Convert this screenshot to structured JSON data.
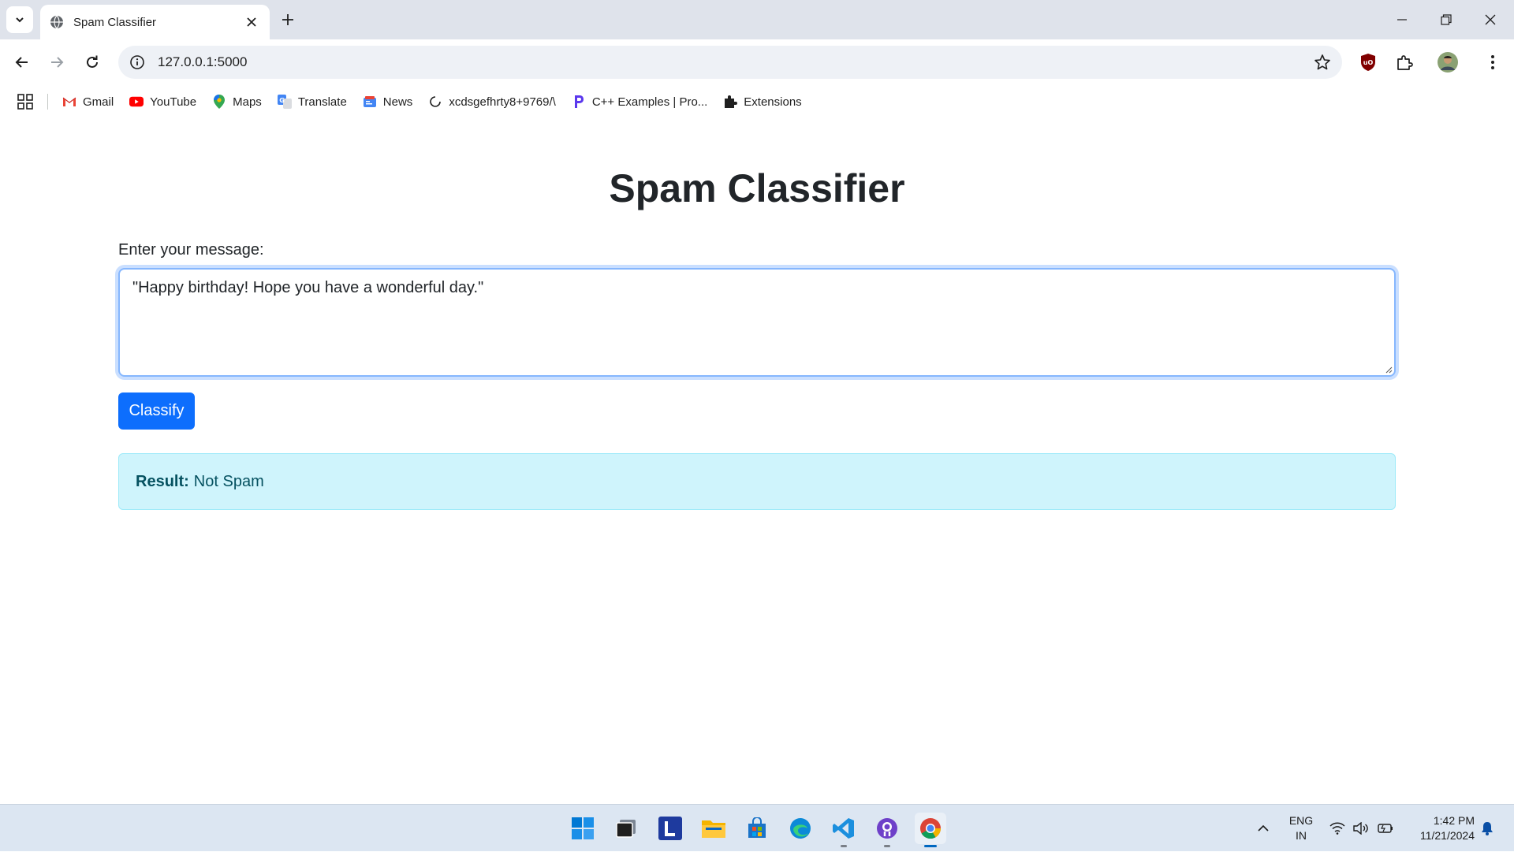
{
  "browser": {
    "tab_title": "Spam Classifier",
    "url": "127.0.0.1:5000",
    "bookmarks": [
      {
        "label": "Gmail",
        "icon": "gmail-icon"
      },
      {
        "label": "YouTube",
        "icon": "youtube-icon"
      },
      {
        "label": "Maps",
        "icon": "maps-icon"
      },
      {
        "label": "Translate",
        "icon": "translate-icon"
      },
      {
        "label": "News",
        "icon": "news-icon"
      },
      {
        "label": "xcdsgefhrty8+9769/\\",
        "icon": "loading-icon"
      },
      {
        "label": "C++ Examples | Pro...",
        "icon": "programiz-icon"
      },
      {
        "label": "Extensions",
        "icon": "puzzle-icon"
      }
    ]
  },
  "page": {
    "title": "Spam Classifier",
    "message_label": "Enter your message:",
    "message_value": "\"Happy birthday! Hope you have a wonderful day.\"",
    "classify_label": "Classify",
    "result_label": "Result:",
    "result_value": "Not Spam"
  },
  "taskbar": {
    "lang_line1": "ENG",
    "lang_line2": "IN",
    "time": "1:42 PM",
    "date": "11/21/2024"
  },
  "colors": {
    "primary": "#0d6efd",
    "result_bg": "#cff4fc",
    "result_text": "#055160",
    "tabstrip_bg": "#dfe3eb",
    "taskbar_bg": "#dce6f2"
  }
}
